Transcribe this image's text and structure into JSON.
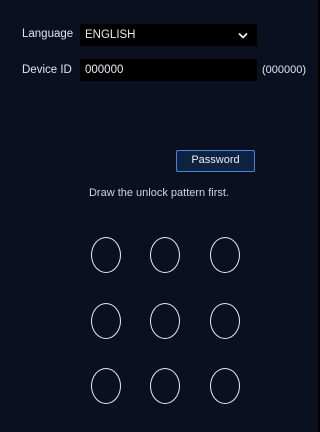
{
  "form": {
    "language_label": "Language",
    "language_value": "ENGLISH",
    "device_id_label": "Device ID",
    "device_id_value": "000000",
    "device_id_hint": "(000000)"
  },
  "actions": {
    "password_label": "Password"
  },
  "pattern": {
    "instruction": "Draw the unlock pattern first.",
    "rows": 3,
    "cols": 3
  },
  "icons": {
    "language_dropdown": "chevron-down-icon"
  },
  "colors": {
    "background": "#0a1020",
    "field_background": "#000000",
    "accent_border": "#3f86e0",
    "text": "#dfe6ee"
  }
}
